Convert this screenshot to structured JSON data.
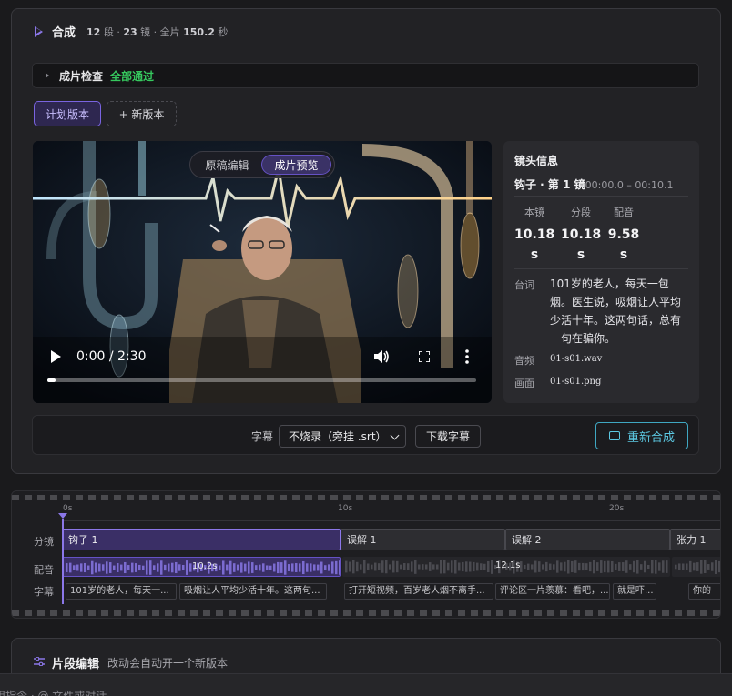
{
  "compose": {
    "title": "合成",
    "meta_segments": "12",
    "meta_seg_label": " 段 · ",
    "meta_shots": "23",
    "meta_shot_label": " 镜 · 全片 ",
    "meta_duration": "150.2",
    "meta_sec": " 秒"
  },
  "check": {
    "label": "成片检查",
    "status": "全部通过",
    "status_color": "#36c85e"
  },
  "versions": {
    "active": "计划版本",
    "add": "+ 新版本"
  },
  "player": {
    "toggle": [
      "原稿编辑",
      "成片预览"
    ],
    "time": "0:00 / 2:30",
    "progress": 0.02
  },
  "shot_info": {
    "title": "镜头信息",
    "shot_name": "钩子 · 第 1 镜",
    "shot_range": "00:00.0 – 00:10.1",
    "stats": [
      {
        "k": "本镜",
        "v": "10.18",
        "u": "s"
      },
      {
        "k": "分段",
        "v": "10.18",
        "u": "s"
      },
      {
        "k": "配音",
        "v": "9.58",
        "u": "s"
      }
    ],
    "line_label": "台词",
    "line_value": "101岁的老人，每天一包烟。医生说，吸烟让人平均少活十年。这两句话，总有一句在骗你。",
    "audio_label": "音频",
    "audio_value": "01-s01.wav",
    "image_label": "画面",
    "image_value": "01-s01.png"
  },
  "subtitle_bar": {
    "label": "字幕",
    "select_value": "不烧录（旁挂 .srt）",
    "download": "下载字幕",
    "recompose": "重新合成"
  },
  "timeline": {
    "ticks": [
      "0s",
      "10s",
      "20s"
    ],
    "row_labels": [
      "分镜",
      "配音",
      "字幕"
    ],
    "clips": [
      "钩子 1",
      "误解 1",
      "误解 2",
      "张力 1"
    ],
    "waves": [
      "10.2s",
      "12.1s"
    ],
    "subs": [
      "101岁的老人，每天一...",
      "吸烟让人平均少活十年。这两句...",
      "打开短视频，百岁老人烟不离手...",
      "评论区一片羡慕：看吧，...",
      "就是吓...",
      "你的"
    ]
  },
  "segment_edit": {
    "title": "片段编辑",
    "desc": "改动会自动开一个新版本"
  },
  "input_hint": "用指令 · @ 文件或对话"
}
